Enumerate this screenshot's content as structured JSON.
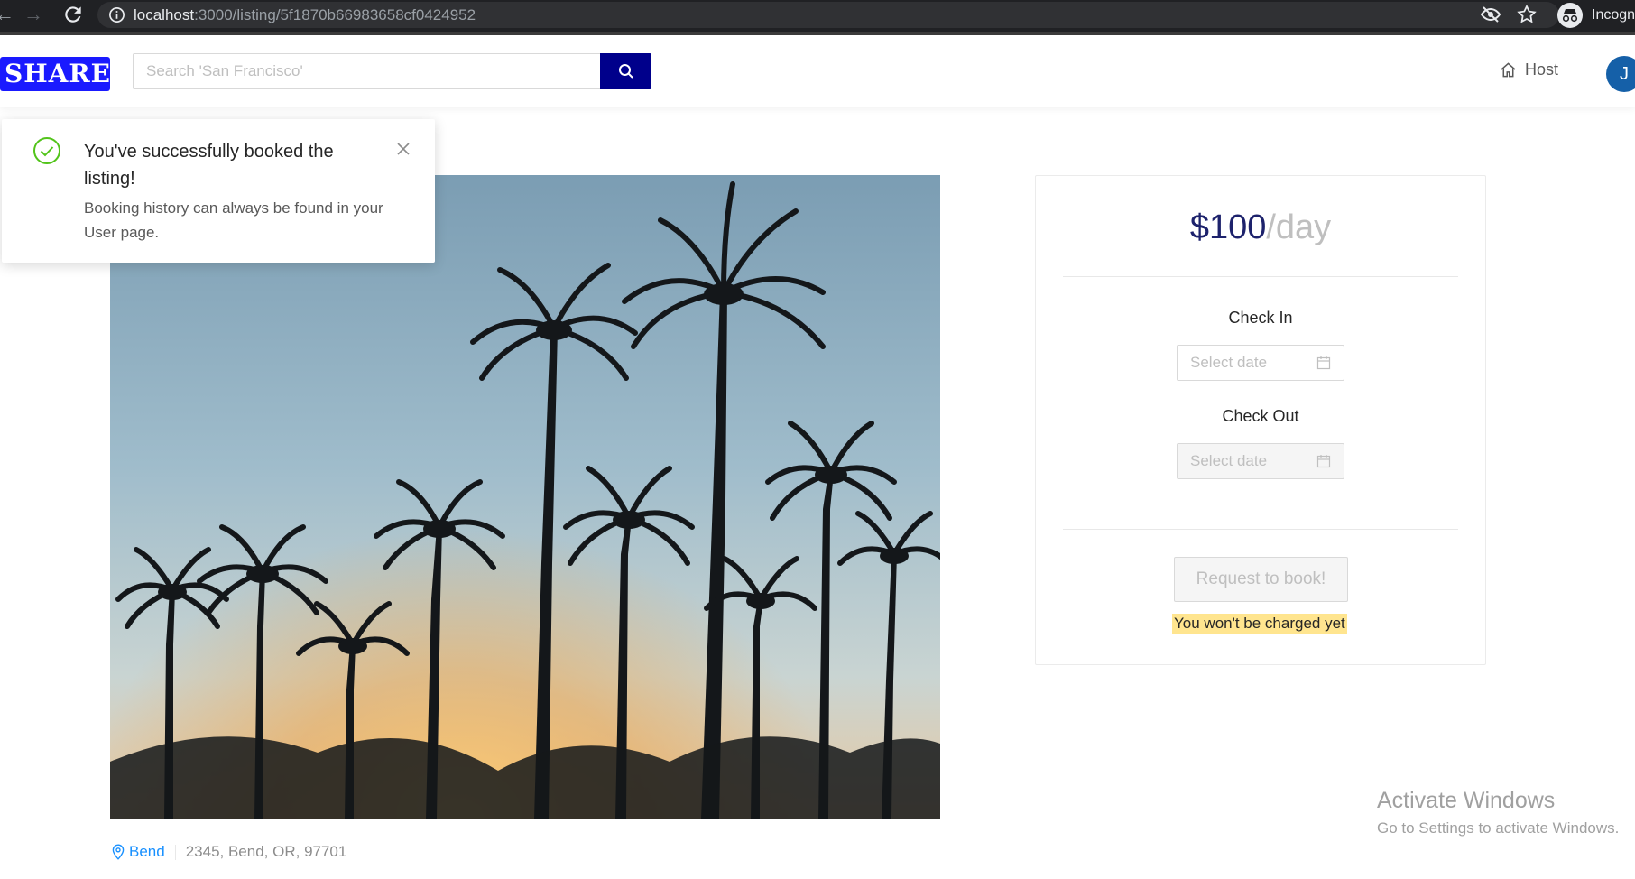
{
  "browser": {
    "url_host": "localhost",
    "url_rest": ":3000/listing/5f1870b66983658cf0424952",
    "profile_label": "Incogn"
  },
  "header": {
    "logo_text": "SHARE",
    "search_placeholder": "Search 'San Francisco'",
    "host_label": "Host",
    "avatar_initial": "J",
    "brand_color": "#00008b"
  },
  "notification": {
    "title": "You've successfully booked the listing!",
    "description": "Booking history can always be found in your User page.",
    "status_color": "#52c41a"
  },
  "listing": {
    "city": "Bend",
    "address": "2345, Bend, OR, 97701"
  },
  "booking": {
    "price": "$100",
    "per": "/day",
    "check_in_label": "Check In",
    "check_in_placeholder": "Select date",
    "check_out_label": "Check Out",
    "check_out_placeholder": "Select date",
    "book_label": "Request to book!",
    "note": "You won't be charged yet"
  },
  "watermark": {
    "line1": "Activate Windows",
    "line2": "Go to Settings to activate Windows."
  }
}
